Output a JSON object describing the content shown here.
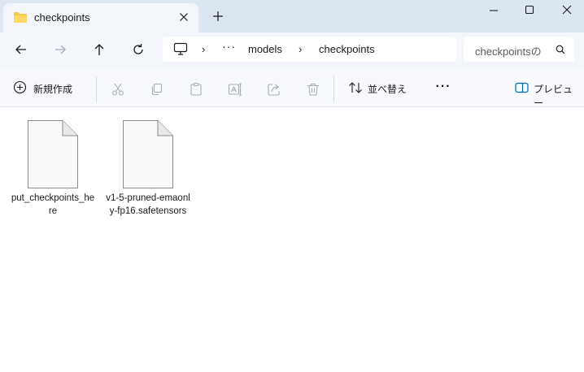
{
  "tab": {
    "title": "checkpoints",
    "icon": "folder-icon",
    "folder_color": "#f7c948"
  },
  "window_controls": [
    "minimize-icon",
    "maximize-icon",
    "close-icon"
  ],
  "address_bar": {
    "breadcrumbs": [
      "models",
      "checkpoints"
    ],
    "overflow": "···"
  },
  "search": {
    "placeholder": "checkpointsの検索"
  },
  "toolbar": {
    "new_label": "新規作成",
    "sort_label": "並べ替え",
    "more_label": "···",
    "preview_label": "プレビュー",
    "actions": [
      "cut-icon",
      "copy-icon",
      "paste-icon",
      "rename-icon",
      "share-icon",
      "delete-icon"
    ]
  },
  "files": [
    {
      "name": "put_checkpoints_here",
      "icon": "document-icon"
    },
    {
      "name": "v1-5-pruned-emaonly-fp16.safetensors",
      "icon": "document-icon"
    }
  ],
  "colors": {
    "titlebar": "#dbe6f1",
    "accent": "#0067c0"
  }
}
